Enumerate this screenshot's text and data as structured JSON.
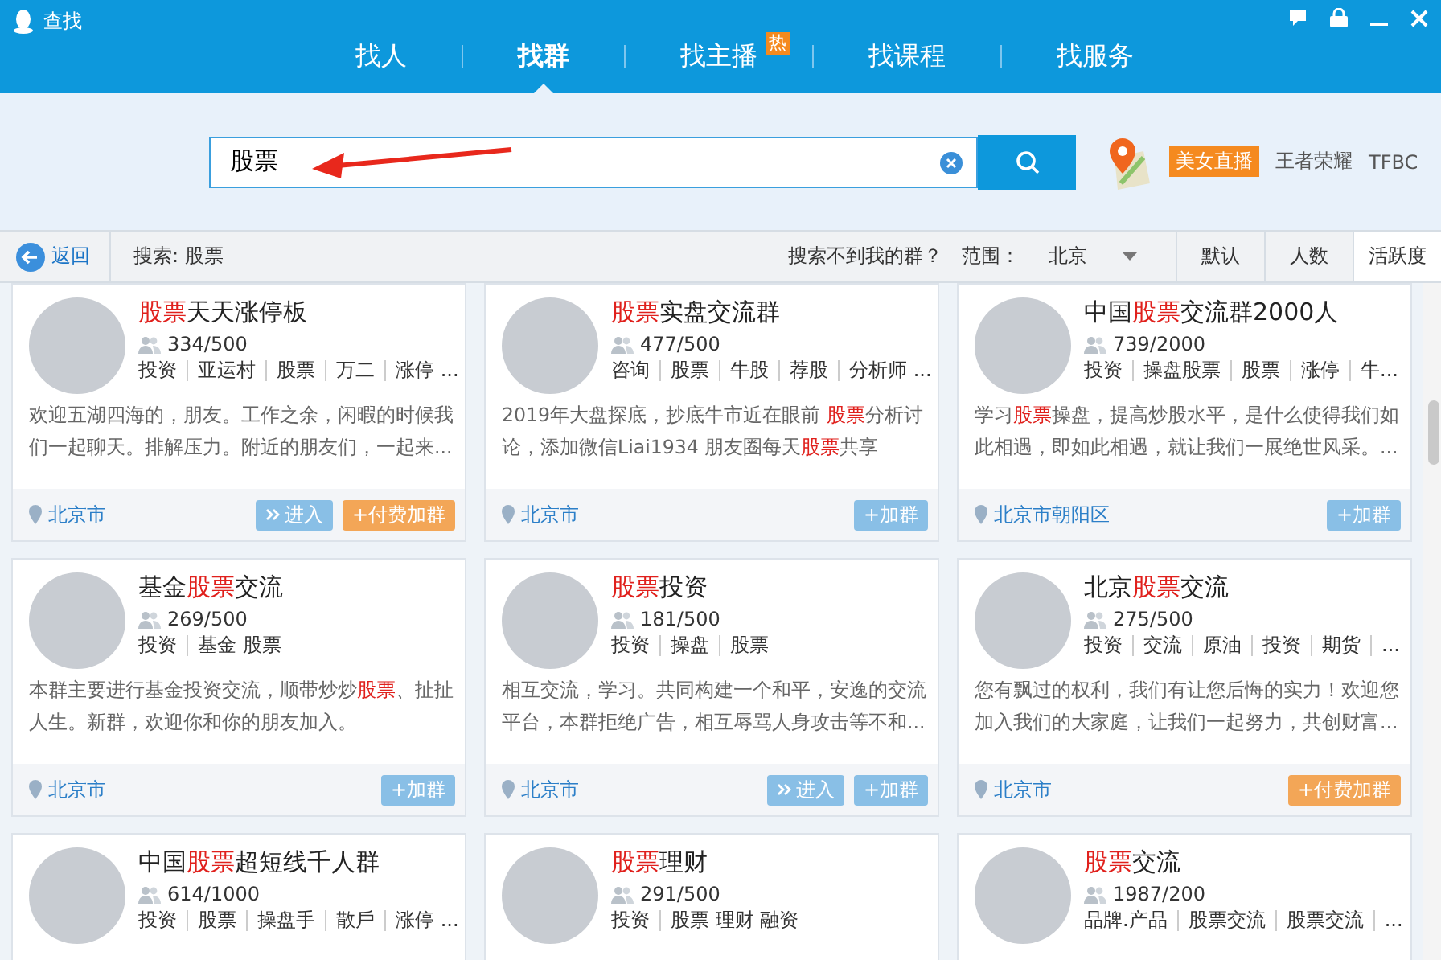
{
  "window": {
    "title": "查找"
  },
  "tabs": [
    {
      "label": "找人",
      "selected": false
    },
    {
      "label": "找群",
      "selected": true
    },
    {
      "label": "找主播",
      "selected": false,
      "badge": "热"
    },
    {
      "label": "找课程",
      "selected": false
    },
    {
      "label": "找服务",
      "selected": false
    }
  ],
  "search": {
    "value": "股票"
  },
  "quick_links": [
    {
      "kind": "badge",
      "label": "美女直播"
    },
    {
      "kind": "plain",
      "label": "王者荣耀"
    },
    {
      "kind": "plain",
      "label": "TFBC"
    }
  ],
  "toolbar": {
    "back": "返回",
    "query": "搜索: 股票",
    "help_link": "搜索不到我的群？",
    "range_label": "范围：",
    "range_value": "北京",
    "sort": [
      {
        "label": "默认",
        "selected": false
      },
      {
        "label": "人数",
        "selected": false
      },
      {
        "label": "活跃度",
        "selected": true
      }
    ]
  },
  "groups": [
    {
      "title": [
        {
          "text": "股票",
          "highlight": true
        },
        {
          "text": "天天涨停板",
          "highlight": false
        }
      ],
      "members": "334/500",
      "tags": [
        "投资",
        "亚运村",
        "股票",
        "万二",
        "涨停 ..."
      ],
      "description": [
        {
          "text": "欢迎五湖四海的，朋友。工作之余，闲暇的时候我们一起聊天。排解压力。附近的朋友们，一起来...",
          "highlight": false
        }
      ],
      "location": "北京市",
      "buttons": [
        {
          "kind": "enter",
          "label": "进入"
        },
        {
          "kind": "paid",
          "label": "+付费加群"
        }
      ]
    },
    {
      "title": [
        {
          "text": "股票",
          "highlight": true
        },
        {
          "text": "实盘交流群",
          "highlight": false
        }
      ],
      "members": "477/500",
      "tags": [
        "咨询",
        "股票",
        "牛股",
        "荐股",
        "分析师 ..."
      ],
      "description": [
        {
          "text": "2019年大盘探底，抄底牛市近在眼前 ",
          "highlight": false
        },
        {
          "text": "股票",
          "highlight": true
        },
        {
          "text": "分析讨论，添加微信Liai1934 朋友圈每天",
          "highlight": false
        },
        {
          "text": "股票",
          "highlight": true
        },
        {
          "text": "共享",
          "highlight": false
        }
      ],
      "location": "北京市",
      "buttons": [
        {
          "kind": "join",
          "label": "+加群"
        }
      ]
    },
    {
      "title": [
        {
          "text": "中国",
          "highlight": false
        },
        {
          "text": "股票",
          "highlight": true
        },
        {
          "text": "交流群2000人",
          "highlight": false
        }
      ],
      "members": "739/2000",
      "tags": [
        "投资",
        "操盘股票",
        "股票",
        "涨停",
        "牛..."
      ],
      "description": [
        {
          "text": "学习",
          "highlight": false
        },
        {
          "text": "股票",
          "highlight": true
        },
        {
          "text": "操盘，提高炒股水平，是什么使得我们如此相遇，即如此相遇，就让我们一展绝世风采。...",
          "highlight": false
        }
      ],
      "location": "北京市朝阳区",
      "buttons": [
        {
          "kind": "join",
          "label": "+加群"
        }
      ]
    },
    {
      "title": [
        {
          "text": "基金",
          "highlight": false
        },
        {
          "text": "股票",
          "highlight": true
        },
        {
          "text": "交流",
          "highlight": false
        }
      ],
      "members": "269/500",
      "tags": [
        "投资",
        "基金 股票"
      ],
      "description": [
        {
          "text": "本群主要进行基金投资交流，顺带炒炒",
          "highlight": false
        },
        {
          "text": "股票",
          "highlight": true
        },
        {
          "text": "、扯扯人生。新群，欢迎你和你的朋友加入。",
          "highlight": false
        }
      ],
      "location": "北京市",
      "buttons": [
        {
          "kind": "join",
          "label": "+加群"
        }
      ]
    },
    {
      "title": [
        {
          "text": "股票",
          "highlight": true
        },
        {
          "text": "投资",
          "highlight": false
        }
      ],
      "members": "181/500",
      "tags": [
        "投资",
        "操盘",
        "股票"
      ],
      "description": [
        {
          "text": "相互交流，学习。共同构建一个和平，安逸的交流平台，本群拒绝广告，相互辱骂人身攻击等不和...",
          "highlight": false
        }
      ],
      "location": "北京市",
      "buttons": [
        {
          "kind": "enter",
          "label": "进入"
        },
        {
          "kind": "join",
          "label": "+加群"
        }
      ]
    },
    {
      "title": [
        {
          "text": "北京",
          "highlight": false
        },
        {
          "text": "股票",
          "highlight": true
        },
        {
          "text": "交流",
          "highlight": false
        }
      ],
      "members": "275/500",
      "tags": [
        "投资",
        "交流",
        "原油",
        "投资",
        "期货",
        "..."
      ],
      "description": [
        {
          "text": "您有飘过的权利，我们有让您后悔的实力！欢迎您加入我们的大家庭，让我们一起努力，共创财富...",
          "highlight": false
        }
      ],
      "location": "北京市",
      "buttons": [
        {
          "kind": "paid",
          "label": "+付费加群"
        }
      ]
    },
    {
      "title": [
        {
          "text": "中国",
          "highlight": false
        },
        {
          "text": "股票",
          "highlight": true
        },
        {
          "text": "超短线千人群",
          "highlight": false
        }
      ],
      "members": "614/1000",
      "tags": [
        "投资",
        "股票",
        "操盘手",
        "散戶",
        "涨停 ..."
      ]
    },
    {
      "title": [
        {
          "text": "股票",
          "highlight": true
        },
        {
          "text": "理财",
          "highlight": false
        }
      ],
      "members": "291/500",
      "tags": [
        "投资",
        "股票 理财 融资"
      ]
    },
    {
      "title": [
        {
          "text": "股票",
          "highlight": true
        },
        {
          "text": "交流",
          "highlight": false
        }
      ],
      "members": "1987/200",
      "tags": [
        "品牌.产品",
        "股票交流",
        "股票交流",
        "..."
      ]
    }
  ]
}
